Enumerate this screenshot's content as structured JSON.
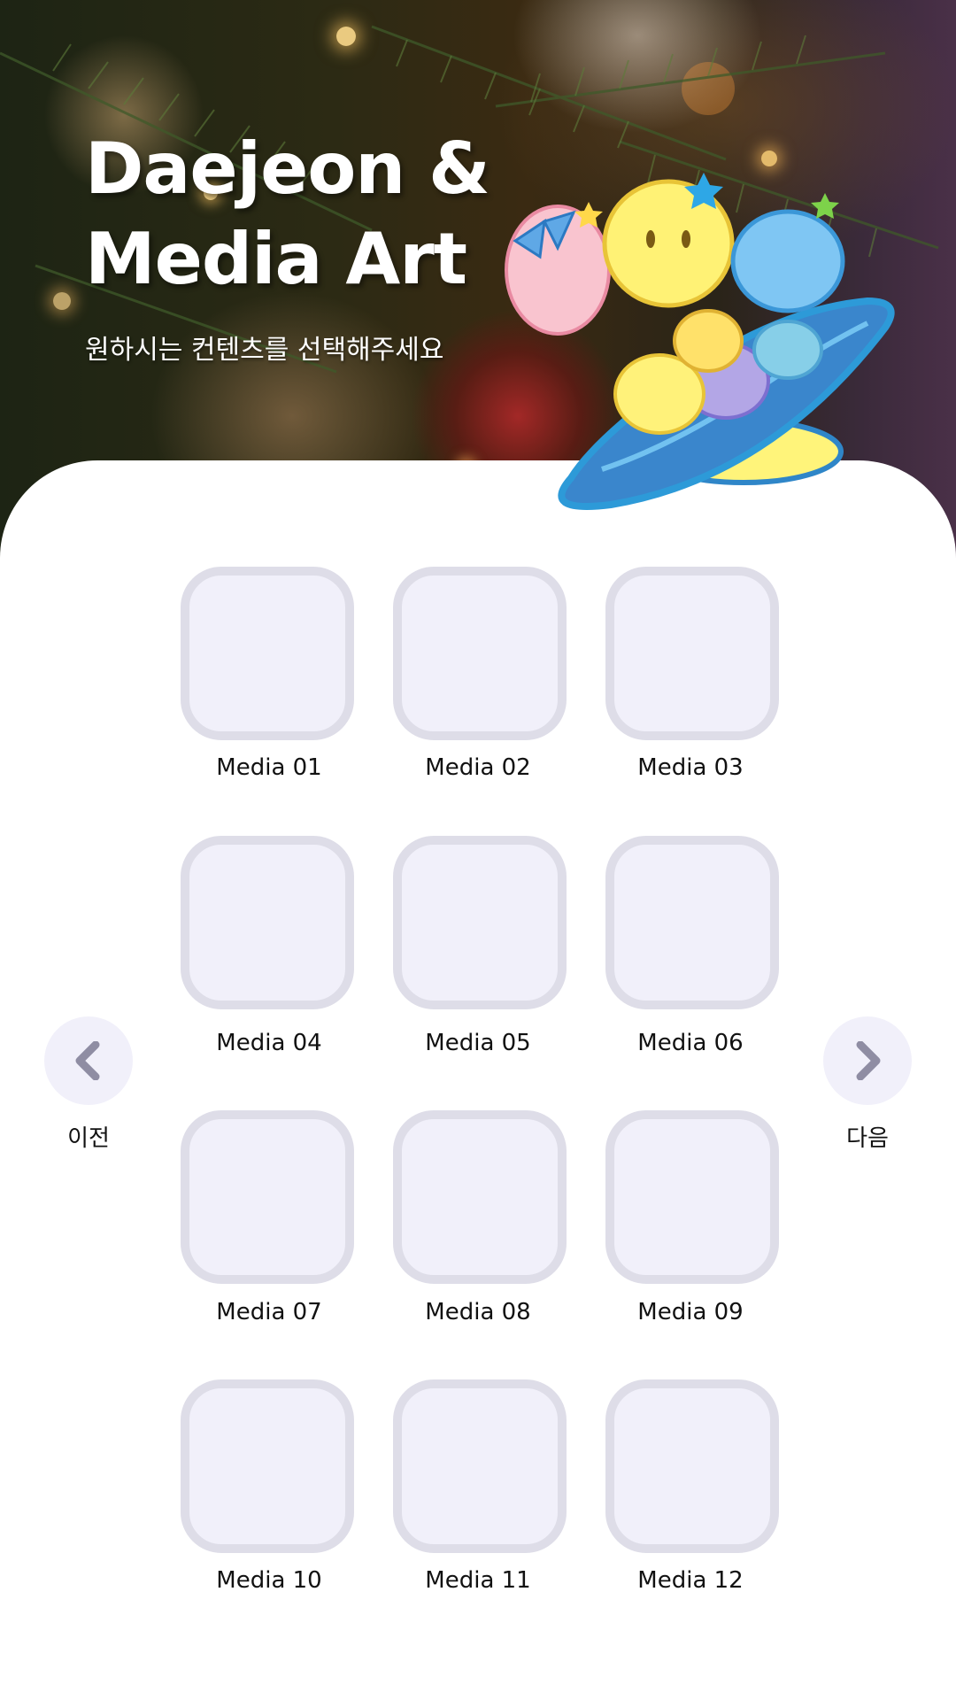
{
  "hero": {
    "title_line1": "Daejeon &",
    "title_line2": "Media Art",
    "subtitle": "원하시는 컨텐츠를 선택해주세요"
  },
  "media": [
    {
      "label": "Media 01"
    },
    {
      "label": "Media 02"
    },
    {
      "label": "Media 03"
    },
    {
      "label": "Media 04"
    },
    {
      "label": "Media 05"
    },
    {
      "label": "Media 06"
    },
    {
      "label": "Media 07"
    },
    {
      "label": "Media 08"
    },
    {
      "label": "Media 09"
    },
    {
      "label": "Media 10"
    },
    {
      "label": "Media 11"
    },
    {
      "label": "Media 12"
    }
  ],
  "nav": {
    "prev_label": "이전",
    "next_label": "다음",
    "prev_icon": "chevron-left-icon",
    "next_icon": "chevron-right-icon"
  },
  "colors": {
    "tile_fill": "#f1f0fa",
    "tile_border": "#dedde8",
    "nav_button": "#f1f0fa",
    "chevron": "#8f8da3"
  }
}
